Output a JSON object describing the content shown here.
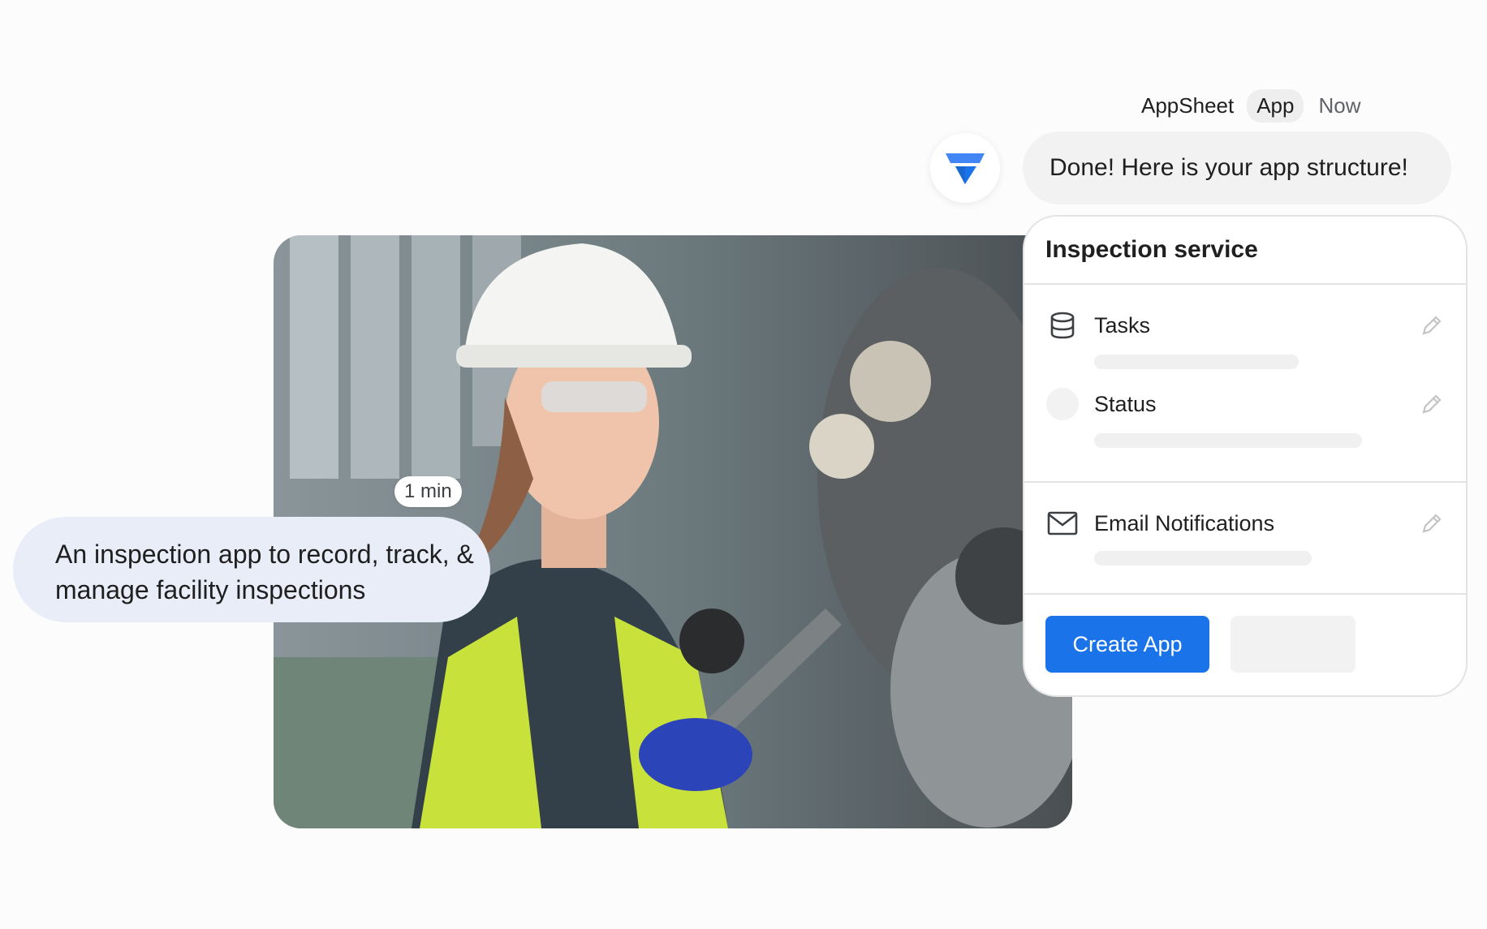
{
  "header": {
    "app_name": "AppSheet",
    "badge": "App",
    "time": "Now"
  },
  "logo": {
    "icon": "appsheet-logo-icon",
    "color": "#1a73e8"
  },
  "reply": {
    "text": "Done! Here is your app structure!"
  },
  "prompt": {
    "duration_chip": "1 min",
    "text": "An inspection app to record, track, & manage facility inspections"
  },
  "photo": {
    "subject": "photo-worker-tablet"
  },
  "card": {
    "title": "Inspection service",
    "items": [
      {
        "label": "Tasks",
        "icon": "database-icon",
        "action_icon": "pencil-icon"
      },
      {
        "label": "Status",
        "icon": "circle-placeholder-icon",
        "action_icon": "pencil-icon"
      },
      {
        "label": "Email Notifications",
        "icon": "mail-icon",
        "action_icon": "pencil-icon"
      }
    ],
    "primary_action": "Create App"
  },
  "colors": {
    "accent": "#1a73e8",
    "prompt_bubble": "#e8edf8",
    "reply_bubble": "#f2f2f2"
  }
}
